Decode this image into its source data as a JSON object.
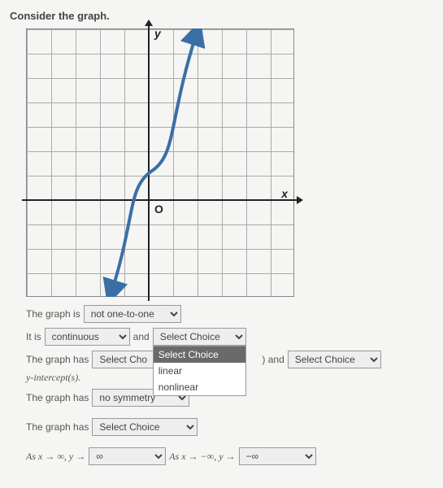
{
  "title": "Consider the graph.",
  "axes": {
    "y": "y",
    "x": "x",
    "origin": "O"
  },
  "q1": {
    "prefix": "The graph is",
    "value": "not one-to-one"
  },
  "q2": {
    "prefix": "It is",
    "value": "continuous",
    "mid": "and",
    "value2": "Select Choice"
  },
  "dropdown_open": {
    "header": "Select Choice",
    "opt1": "linear",
    "opt2": "nonlinear"
  },
  "q3": {
    "prefix": "The graph has",
    "value": "Select Cho",
    "mid": ") and",
    "value2": "Select Choice",
    "suffix": "y-intercept(s)."
  },
  "q4": {
    "prefix": "The graph has",
    "value": "no symmetry"
  },
  "q5": {
    "prefix": "The graph has",
    "value": "Select Choice"
  },
  "q6": {
    "p1": "As x → ∞, y →",
    "v1": "∞",
    "p2": "As x → −∞, y →",
    "v2": "−∞"
  }
}
